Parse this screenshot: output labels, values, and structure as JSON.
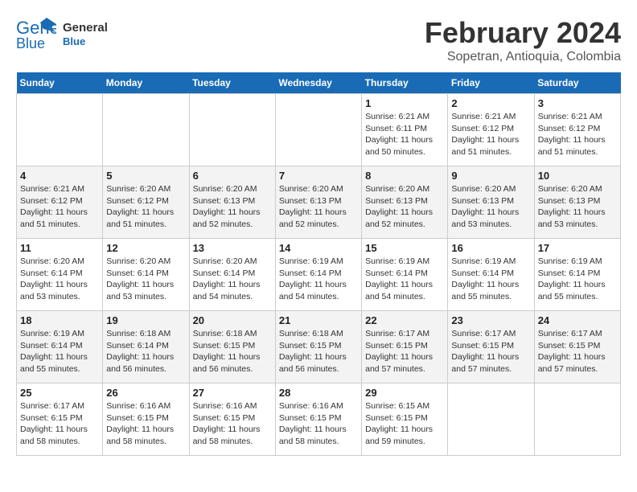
{
  "logo": {
    "line1": "General",
    "line2": "Blue"
  },
  "title": "February 2024",
  "subtitle": "Sopetran, Antioquia, Colombia",
  "days_of_week": [
    "Sunday",
    "Monday",
    "Tuesday",
    "Wednesday",
    "Thursday",
    "Friday",
    "Saturday"
  ],
  "weeks": [
    [
      {
        "day": "",
        "info": ""
      },
      {
        "day": "",
        "info": ""
      },
      {
        "day": "",
        "info": ""
      },
      {
        "day": "",
        "info": ""
      },
      {
        "day": "1",
        "info": "Sunrise: 6:21 AM\nSunset: 6:11 PM\nDaylight: 11 hours and 50 minutes."
      },
      {
        "day": "2",
        "info": "Sunrise: 6:21 AM\nSunset: 6:12 PM\nDaylight: 11 hours and 51 minutes."
      },
      {
        "day": "3",
        "info": "Sunrise: 6:21 AM\nSunset: 6:12 PM\nDaylight: 11 hours and 51 minutes."
      }
    ],
    [
      {
        "day": "4",
        "info": "Sunrise: 6:21 AM\nSunset: 6:12 PM\nDaylight: 11 hours and 51 minutes."
      },
      {
        "day": "5",
        "info": "Sunrise: 6:20 AM\nSunset: 6:12 PM\nDaylight: 11 hours and 51 minutes."
      },
      {
        "day": "6",
        "info": "Sunrise: 6:20 AM\nSunset: 6:13 PM\nDaylight: 11 hours and 52 minutes."
      },
      {
        "day": "7",
        "info": "Sunrise: 6:20 AM\nSunset: 6:13 PM\nDaylight: 11 hours and 52 minutes."
      },
      {
        "day": "8",
        "info": "Sunrise: 6:20 AM\nSunset: 6:13 PM\nDaylight: 11 hours and 52 minutes."
      },
      {
        "day": "9",
        "info": "Sunrise: 6:20 AM\nSunset: 6:13 PM\nDaylight: 11 hours and 53 minutes."
      },
      {
        "day": "10",
        "info": "Sunrise: 6:20 AM\nSunset: 6:13 PM\nDaylight: 11 hours and 53 minutes."
      }
    ],
    [
      {
        "day": "11",
        "info": "Sunrise: 6:20 AM\nSunset: 6:14 PM\nDaylight: 11 hours and 53 minutes."
      },
      {
        "day": "12",
        "info": "Sunrise: 6:20 AM\nSunset: 6:14 PM\nDaylight: 11 hours and 53 minutes."
      },
      {
        "day": "13",
        "info": "Sunrise: 6:20 AM\nSunset: 6:14 PM\nDaylight: 11 hours and 54 minutes."
      },
      {
        "day": "14",
        "info": "Sunrise: 6:19 AM\nSunset: 6:14 PM\nDaylight: 11 hours and 54 minutes."
      },
      {
        "day": "15",
        "info": "Sunrise: 6:19 AM\nSunset: 6:14 PM\nDaylight: 11 hours and 54 minutes."
      },
      {
        "day": "16",
        "info": "Sunrise: 6:19 AM\nSunset: 6:14 PM\nDaylight: 11 hours and 55 minutes."
      },
      {
        "day": "17",
        "info": "Sunrise: 6:19 AM\nSunset: 6:14 PM\nDaylight: 11 hours and 55 minutes."
      }
    ],
    [
      {
        "day": "18",
        "info": "Sunrise: 6:19 AM\nSunset: 6:14 PM\nDaylight: 11 hours and 55 minutes."
      },
      {
        "day": "19",
        "info": "Sunrise: 6:18 AM\nSunset: 6:14 PM\nDaylight: 11 hours and 56 minutes."
      },
      {
        "day": "20",
        "info": "Sunrise: 6:18 AM\nSunset: 6:15 PM\nDaylight: 11 hours and 56 minutes."
      },
      {
        "day": "21",
        "info": "Sunrise: 6:18 AM\nSunset: 6:15 PM\nDaylight: 11 hours and 56 minutes."
      },
      {
        "day": "22",
        "info": "Sunrise: 6:17 AM\nSunset: 6:15 PM\nDaylight: 11 hours and 57 minutes."
      },
      {
        "day": "23",
        "info": "Sunrise: 6:17 AM\nSunset: 6:15 PM\nDaylight: 11 hours and 57 minutes."
      },
      {
        "day": "24",
        "info": "Sunrise: 6:17 AM\nSunset: 6:15 PM\nDaylight: 11 hours and 57 minutes."
      }
    ],
    [
      {
        "day": "25",
        "info": "Sunrise: 6:17 AM\nSunset: 6:15 PM\nDaylight: 11 hours and 58 minutes."
      },
      {
        "day": "26",
        "info": "Sunrise: 6:16 AM\nSunset: 6:15 PM\nDaylight: 11 hours and 58 minutes."
      },
      {
        "day": "27",
        "info": "Sunrise: 6:16 AM\nSunset: 6:15 PM\nDaylight: 11 hours and 58 minutes."
      },
      {
        "day": "28",
        "info": "Sunrise: 6:16 AM\nSunset: 6:15 PM\nDaylight: 11 hours and 58 minutes."
      },
      {
        "day": "29",
        "info": "Sunrise: 6:15 AM\nSunset: 6:15 PM\nDaylight: 11 hours and 59 minutes."
      },
      {
        "day": "",
        "info": ""
      },
      {
        "day": "",
        "info": ""
      }
    ]
  ]
}
